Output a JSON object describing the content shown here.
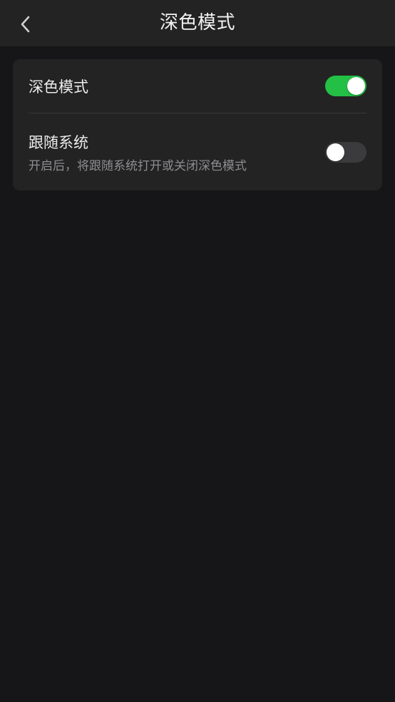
{
  "header": {
    "title": "深色模式",
    "back_icon": "chevron-left-icon"
  },
  "settings": {
    "dark_mode": {
      "label": "深色模式",
      "enabled": true
    },
    "follow_system": {
      "label": "跟随系统",
      "description": "开启后，将跟随系统打开或关闭深色模式",
      "enabled": false
    }
  },
  "colors": {
    "background": "#161618",
    "surface": "#232323",
    "toggle_on": "#24c045",
    "toggle_off": "#3b3b3d",
    "text_primary": "#ececec",
    "text_secondary": "#8d8d92"
  }
}
